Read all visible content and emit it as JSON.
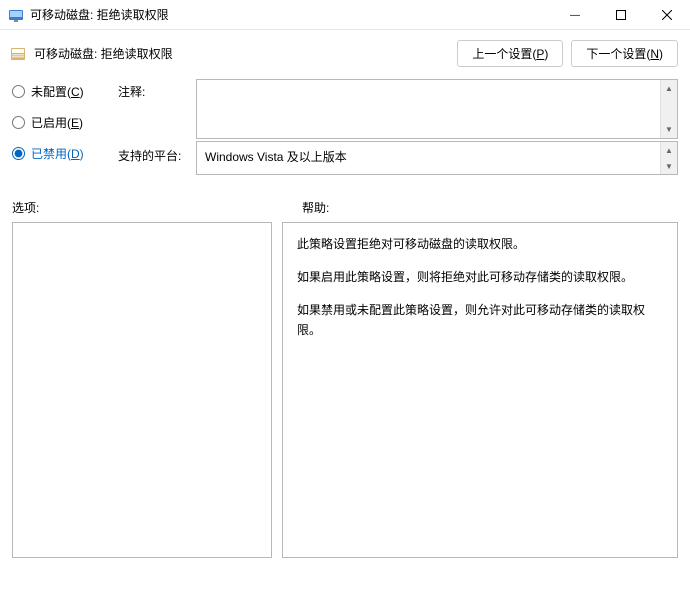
{
  "window": {
    "title": "可移动磁盘: 拒绝读取权限",
    "minimize": "—",
    "maximize": "▢",
    "close": "✕"
  },
  "policy": {
    "title": "可移动磁盘: 拒绝读取权限",
    "prev_btn_pre": "上一个设置(",
    "prev_btn_u": "P",
    "prev_btn_post": ")",
    "next_btn_pre": "下一个设置(",
    "next_btn_u": "N",
    "next_btn_post": ")"
  },
  "radios": {
    "not_configured_pre": "未配置(",
    "not_configured_u": "C",
    "not_configured_post": ")",
    "enabled_pre": "已启用(",
    "enabled_u": "E",
    "enabled_post": ")",
    "disabled_pre": "已禁用(",
    "disabled_u": "D",
    "disabled_post": ")"
  },
  "labels": {
    "comment": "注释:",
    "platform": "支持的平台:",
    "options": "选项:",
    "help": "帮助:"
  },
  "platform": {
    "value": "Windows Vista 及以上版本"
  },
  "help": {
    "p1": "此策略设置拒绝对可移动磁盘的读取权限。",
    "p2": "如果启用此策略设置，则将拒绝对此可移动存储类的读取权限。",
    "p3": "如果禁用或未配置此策略设置，则允许对此可移动存储类的读取权限。"
  }
}
